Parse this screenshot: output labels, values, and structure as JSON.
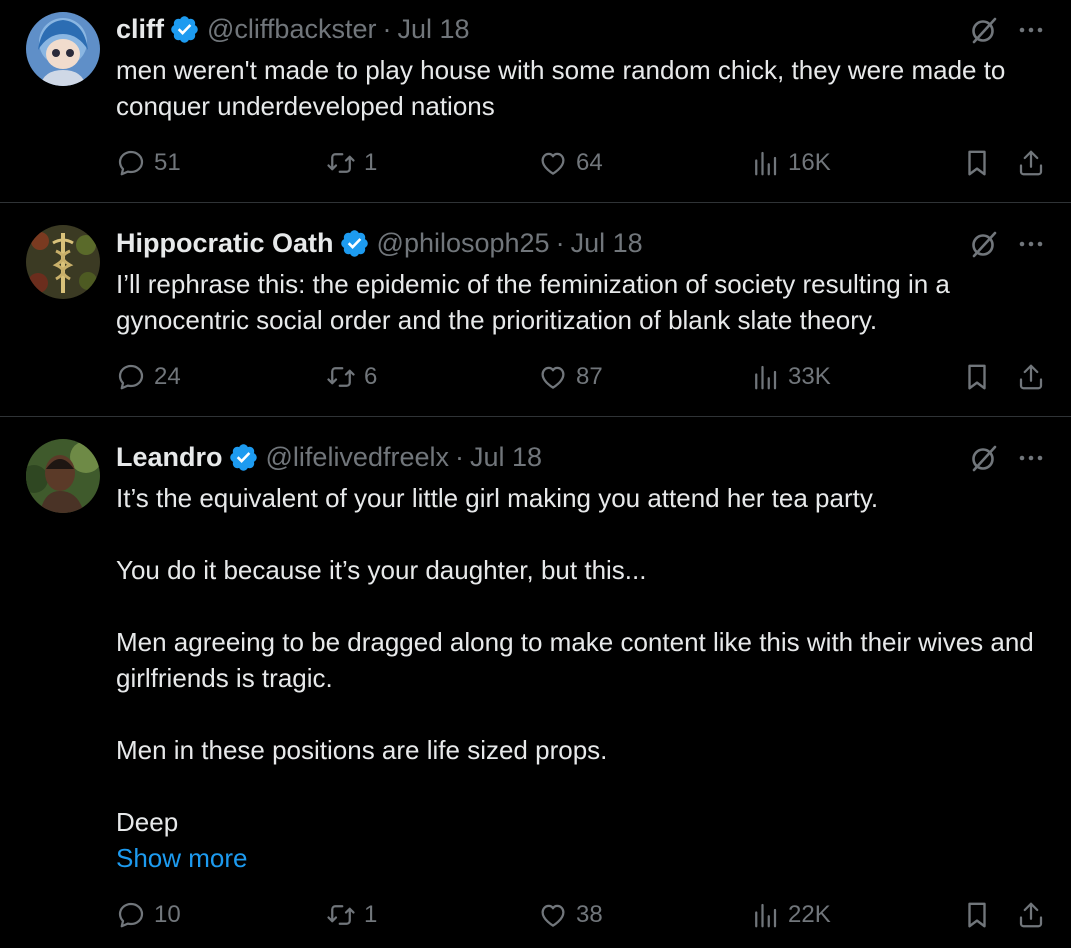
{
  "tweets": [
    {
      "name": "cliff",
      "handle": "@cliffbackster",
      "sep": "·",
      "date": "Jul 18",
      "body": [
        "men weren't made to play house with some random chick, they were made to conquer underdeveloped nations"
      ],
      "replies": "51",
      "retweets": "1",
      "likes": "64",
      "views": "16K"
    },
    {
      "name": "Hippocratic Oath",
      "handle": "@philosoph25",
      "sep": "·",
      "date": "Jul 18",
      "body": [
        "I’ll rephrase this: the epidemic of the feminization of society resulting in a gynocentric social order and the prioritization of blank slate theory."
      ],
      "replies": "24",
      "retweets": "6",
      "likes": "87",
      "views": "33K"
    },
    {
      "name": "Leandro",
      "handle": "@lifelivedfreelx",
      "sep": "·",
      "date": "Jul 18",
      "body": [
        "It’s the equivalent of your little girl making you attend her tea party.",
        "You do it because it’s your daughter, but this...",
        "Men agreeing to be dragged along to make content like this with their wives and girlfriends is tragic.",
        "Men in these positions are life sized props.",
        "Deep"
      ],
      "show_more": "Show more",
      "replies": "10",
      "retweets": "1",
      "likes": "38",
      "views": "22K"
    }
  ],
  "icons": {
    "verified": "verified-badge-icon",
    "grok": "grok-icon",
    "more": "more-icon",
    "reply": "reply-icon",
    "retweet": "retweet-icon",
    "like": "like-icon",
    "views": "views-icon",
    "bookmark": "bookmark-icon",
    "share": "share-icon"
  },
  "colors": {
    "background": "#000000",
    "text": "#e7e9ea",
    "secondary": "#71767b",
    "accent": "#1d9bf0",
    "divider": "#2f3336"
  }
}
